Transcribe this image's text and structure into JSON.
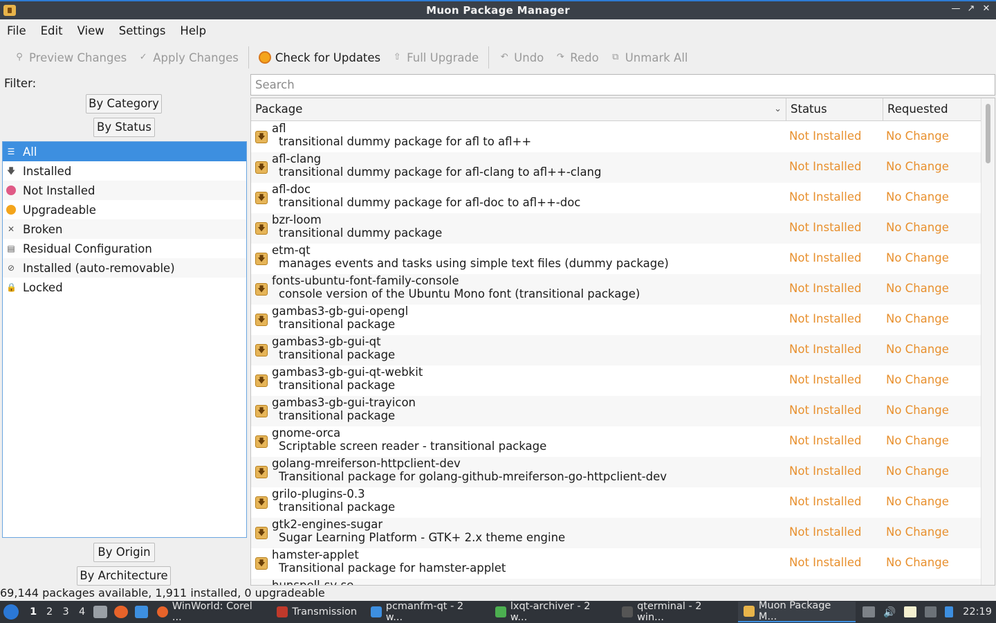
{
  "window": {
    "title": "Muon Package Manager"
  },
  "menu": [
    "File",
    "Edit",
    "View",
    "Settings",
    "Help"
  ],
  "toolbar": {
    "preview": "Preview Changes",
    "apply": "Apply Changes",
    "check": "Check for Updates",
    "upgrade": "Full Upgrade",
    "undo": "Undo",
    "redo": "Redo",
    "unmark": "Unmark All"
  },
  "filter": {
    "label": "Filter:",
    "by_category": "By Category",
    "by_status": "By Status",
    "by_origin": "By Origin",
    "by_architecture": "By Architecture",
    "status_items": [
      "All",
      "Installed",
      "Not Installed",
      "Upgradeable",
      "Broken",
      "Residual Configuration",
      "Installed (auto-removable)",
      "Locked"
    ]
  },
  "search": {
    "placeholder": "Search"
  },
  "table": {
    "headers": {
      "package": "Package",
      "status": "Status",
      "requested": "Requested"
    },
    "rows": [
      {
        "name": "afl",
        "desc": "transitional dummy package for afl to afl++",
        "status": "Not Installed",
        "requested": "No Change"
      },
      {
        "name": "afl-clang",
        "desc": "transitional dummy package for afl-clang to afl++-clang",
        "status": "Not Installed",
        "requested": "No Change"
      },
      {
        "name": "afl-doc",
        "desc": "transitional dummy package for afl-doc to afl++-doc",
        "status": "Not Installed",
        "requested": "No Change"
      },
      {
        "name": "bzr-loom",
        "desc": "transitional dummy package",
        "status": "Not Installed",
        "requested": "No Change"
      },
      {
        "name": "etm-qt",
        "desc": "manages events and tasks using simple text files (dummy package)",
        "status": "Not Installed",
        "requested": "No Change"
      },
      {
        "name": "fonts-ubuntu-font-family-console",
        "desc": "console version of the Ubuntu Mono font (transitional package)",
        "status": "Not Installed",
        "requested": "No Change"
      },
      {
        "name": "gambas3-gb-gui-opengl",
        "desc": "transitional package",
        "status": "Not Installed",
        "requested": "No Change"
      },
      {
        "name": "gambas3-gb-gui-qt",
        "desc": "transitional package",
        "status": "Not Installed",
        "requested": "No Change"
      },
      {
        "name": "gambas3-gb-gui-qt-webkit",
        "desc": "transitional package",
        "status": "Not Installed",
        "requested": "No Change"
      },
      {
        "name": "gambas3-gb-gui-trayicon",
        "desc": "transitional package",
        "status": "Not Installed",
        "requested": "No Change"
      },
      {
        "name": "gnome-orca",
        "desc": "Scriptable screen reader - transitional package",
        "status": "Not Installed",
        "requested": "No Change"
      },
      {
        "name": "golang-mreiferson-httpclient-dev",
        "desc": "Transitional package for golang-github-mreiferson-go-httpclient-dev",
        "status": "Not Installed",
        "requested": "No Change"
      },
      {
        "name": "grilo-plugins-0.3",
        "desc": "transitional package",
        "status": "Not Installed",
        "requested": "No Change"
      },
      {
        "name": "gtk2-engines-sugar",
        "desc": "Sugar Learning Platform - GTK+ 2.x theme engine",
        "status": "Not Installed",
        "requested": "No Change"
      },
      {
        "name": "hamster-applet",
        "desc": "Transitional package for hamster-applet",
        "status": "Not Installed",
        "requested": "No Change"
      },
      {
        "name": "hunspell-sv-se",
        "desc": "",
        "status": "",
        "requested": ""
      }
    ]
  },
  "statusbar": {
    "text": "69,144 packages available, 1,911 installed, 0 upgradeable"
  },
  "taskbar": {
    "desktops": [
      "1",
      "2",
      "3",
      "4"
    ],
    "tasks": [
      "WinWorld: Corel ...",
      "Transmission",
      "pcmanfm-qt - 2 w...",
      "lxqt-archiver - 2 w...",
      "qterminal - 2 win...",
      "Muon Package M..."
    ],
    "clock": "22:19"
  },
  "colors": {
    "accent": "#3d8fe0",
    "status_text": "#e8902e",
    "titlebar": "#3a4048"
  }
}
